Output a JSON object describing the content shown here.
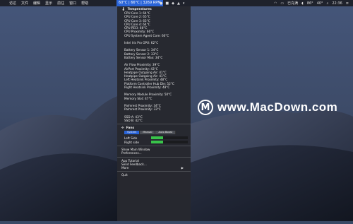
{
  "menubar": {
    "apple": "",
    "left_items": [
      "访达",
      "文件",
      "编辑",
      "显示",
      "前往",
      "窗口",
      "帮助"
    ],
    "stats": "60°C | 66°C | 3269 RPM",
    "right_items": [
      "已充满",
      "86°",
      "40°",
      "22:36"
    ]
  },
  "menu": {
    "temperatures_title": "Temperatures",
    "groups": [
      [
        "CPU Core 1: 64°C",
        "CPU Core 2: 65°C",
        "CPU Core 3: 65°C",
        "CPU Core 4: 64°C",
        "CPU PECI: 66°C",
        "CPU Proximity: 66°C",
        "CPU System Agent Core: 60°C"
      ],
      [
        "Intel Iris Pro GPU: 62°C"
      ],
      [
        "Battery Sensor 1: 34°C",
        "Battery Sensor 2: 33°C",
        "Battery Sensor Max: 34°C"
      ],
      [
        "Air Flow Proximity: 39°C",
        "AirPort Proximity: 43°C",
        "Heatpipe Outgoing Air: 41°C",
        "Heatpipe Outgoing Air: 41°C",
        "Left Heatsink Proximity: 48°C",
        "Platform Controller Hub Die: 52°C",
        "Right Heatsink Proximity: 48°C"
      ],
      [
        "Memory Module Proximity: 50°C",
        "Memory Slot: 47°C"
      ],
      [
        "Palmrest Proximity: 34°C",
        "Palmrest Proximity: 33°C"
      ],
      [
        "SSD A: 43°C",
        "SSD B: 42°C"
      ]
    ],
    "fans_title": "Fans",
    "fan_modes": [
      "System",
      "Manual",
      "Auto Boost"
    ],
    "active_mode": "System",
    "fans": [
      {
        "label": "Left Side",
        "level": 0.32
      },
      {
        "label": "Right side",
        "level": 0.32
      }
    ],
    "show_main_window": "Show Main Window",
    "preferences": "Preferences...",
    "app_tutorial": "App Tutorial",
    "send_feedback": "Send Feedback...",
    "more": "More",
    "more_arrow": "▶",
    "quit": "Quit"
  },
  "watermark": {
    "logo": "M",
    "text": "www.MacDown.com"
  },
  "colors": {
    "accent": "#2a64d8",
    "fan_fill": "#39c44a",
    "menu_bg": "#26282e"
  }
}
